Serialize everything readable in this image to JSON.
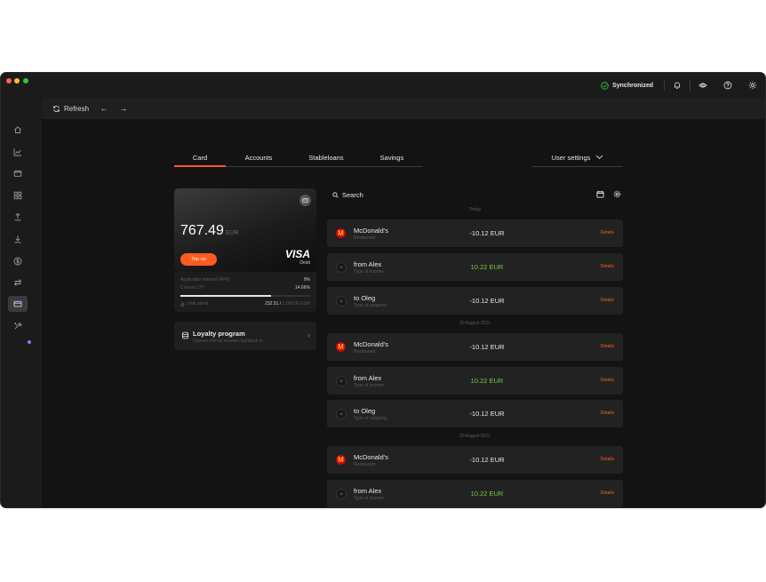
{
  "topbar": {
    "sync_label": "Synchronized",
    "icons": [
      "bell-icon",
      "eye-icon",
      "help-icon",
      "settings-icon"
    ],
    "accent": "#28c840"
  },
  "toolbar": {
    "refresh_label": "Refresh",
    "back_arrow": "←",
    "forward_arrow": "→"
  },
  "sidebar": {
    "items": [
      "home-icon",
      "chart-icon",
      "wallet-icon",
      "grid-icon",
      "upload-icon",
      "download-icon",
      "dollar-icon",
      "exchange-icon",
      "card-icon",
      "tools-icon"
    ],
    "active": "card-icon"
  },
  "tabs": {
    "items": [
      "Card",
      "Accounts",
      "Stableloans",
      "Savings"
    ],
    "active": "Card",
    "user_settings": "User settings",
    "accent": "#ff5a1f"
  },
  "card": {
    "balance": "767.49",
    "currency": "EUR",
    "topup_label": "Top up",
    "brand": "VISA",
    "brand_sub": "Debit",
    "apr_label": "Applicable interest (APR)",
    "apr_value": "0%",
    "ltv_label": "Current LTV",
    "ltv_value": "14.66%",
    "ltv_level_percent": 70,
    "limit_label": "Limit spent",
    "limit_spent": "232.51 /",
    "limit_total": "1,000.00 EUR"
  },
  "loyalty": {
    "title": "Loyalty program",
    "subtitle": "Choose coin to receive cashback in"
  },
  "transactions": {
    "search_label": "Search",
    "details_label": "Details",
    "groups": [
      {
        "label": "Today"
      },
      {
        "label": "20 August 2021"
      },
      {
        "label": "20 August 2021"
      }
    ],
    "rows": [
      {
        "title": "McDonald's",
        "sub": "Restaurant",
        "amount": "-10.12 EUR"
      },
      {
        "title": "from Alex",
        "sub": "Type of income",
        "amount": "10.22 EUR"
      },
      {
        "title": "to Oleg",
        "sub": "Type of outgoing",
        "amount": "-10.12 EUR"
      },
      {
        "title": "McDonald's",
        "sub": "Restaurant",
        "amount": "-10.12 EUR"
      },
      {
        "title": "from Alex",
        "sub": "Type of income",
        "amount": "10.22 EUR"
      },
      {
        "title": "to Oleg",
        "sub": "Type of outgoing",
        "amount": "-10.12 EUR"
      },
      {
        "title": "McDonald's",
        "sub": "Restaurant",
        "amount": "-10.12 EUR"
      },
      {
        "title": "from Alex",
        "sub": "Type of income",
        "amount": "10.22 EUR"
      }
    ],
    "positive_color": "#7ec83f"
  }
}
